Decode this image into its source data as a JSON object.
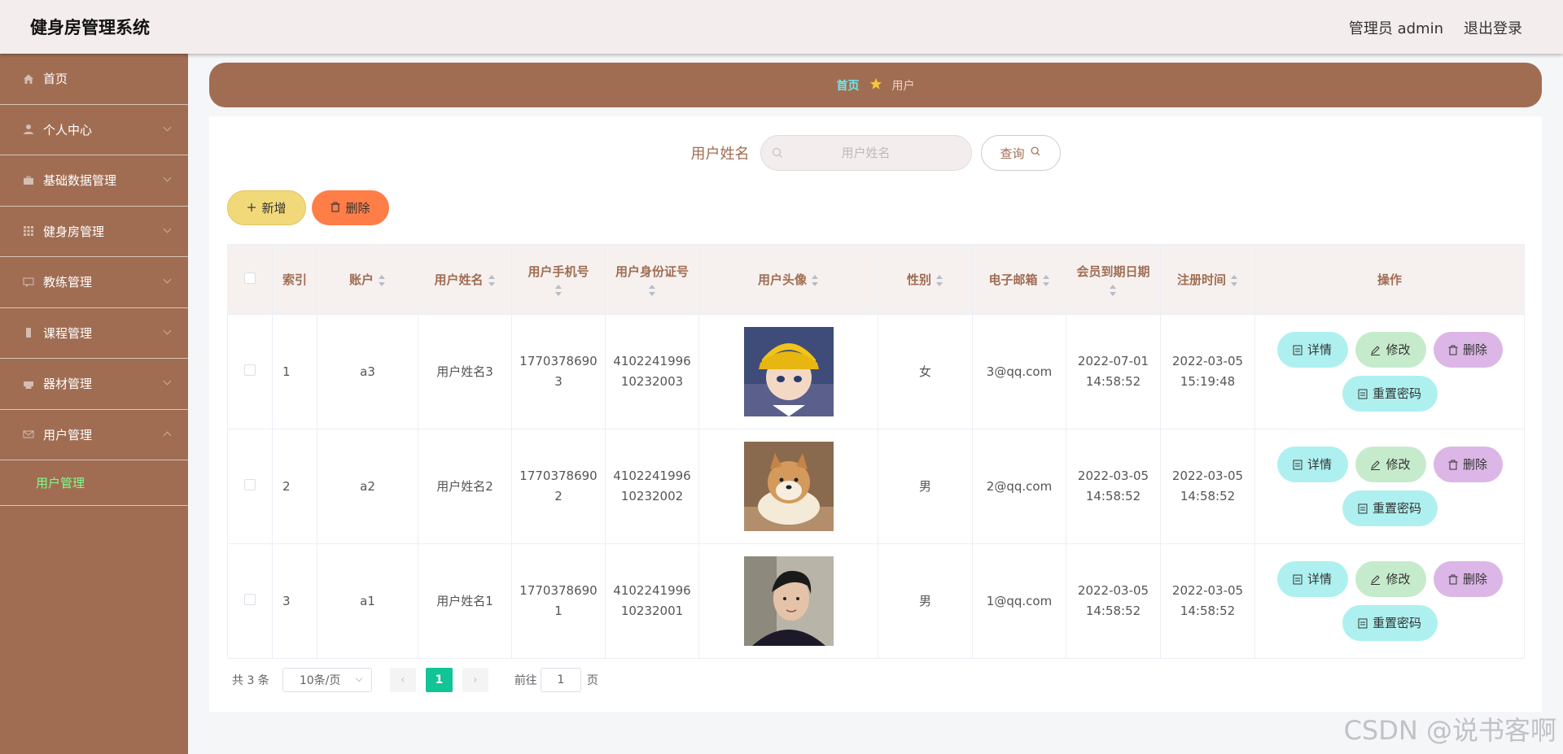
{
  "header": {
    "title": "健身房管理系统",
    "user": "管理员 admin",
    "logout": "退出登录"
  },
  "sidebar": {
    "items": [
      {
        "label": "首页",
        "icon": "home-icon"
      },
      {
        "label": "个人中心",
        "icon": "user-icon"
      },
      {
        "label": "基础数据管理",
        "icon": "briefcase-icon"
      },
      {
        "label": "健身房管理",
        "icon": "grid-icon"
      },
      {
        "label": "教练管理",
        "icon": "chat-icon"
      },
      {
        "label": "课程管理",
        "icon": "phone-icon"
      },
      {
        "label": "器材管理",
        "icon": "printer-icon"
      },
      {
        "label": "用户管理",
        "icon": "mail-icon"
      }
    ],
    "subitem": "用户管理"
  },
  "breadcrumb": {
    "home": "首页",
    "current": "用户"
  },
  "search": {
    "label": "用户姓名",
    "placeholder": "用户姓名",
    "button": "查询"
  },
  "actions": {
    "add": "新增",
    "delete": "删除"
  },
  "table": {
    "headers": [
      "索引",
      "账户",
      "用户姓名",
      "用户手机号",
      "用户身份证号",
      "用户头像",
      "性别",
      "电子邮箱",
      "会员到期日期",
      "注册时间",
      "操作"
    ],
    "rows": [
      {
        "index": "1",
        "account": "a3",
        "name": "用户姓名3",
        "phone_a": "1770378690",
        "phone_b": "3",
        "id_a": "4102241996",
        "id_b": "10232003",
        "gender": "女",
        "email": "3@qq.com",
        "expire_a": "2022-07-01",
        "expire_b": "14:58:52",
        "reg_a": "2022-03-05",
        "reg_b": "15:19:48"
      },
      {
        "index": "2",
        "account": "a2",
        "name": "用户姓名2",
        "phone_a": "1770378690",
        "phone_b": "2",
        "id_a": "4102241996",
        "id_b": "10232002",
        "gender": "男",
        "email": "2@qq.com",
        "expire_a": "2022-03-05",
        "expire_b": "14:58:52",
        "reg_a": "2022-03-05",
        "reg_b": "14:58:52"
      },
      {
        "index": "3",
        "account": "a1",
        "name": "用户姓名1",
        "phone_a": "1770378690",
        "phone_b": "1",
        "id_a": "4102241996",
        "id_b": "10232001",
        "gender": "男",
        "email": "1@qq.com",
        "expire_a": "2022-03-05",
        "expire_b": "14:58:52",
        "reg_a": "2022-03-05",
        "reg_b": "14:58:52"
      }
    ],
    "ops": {
      "detail": "详情",
      "edit": "修改",
      "delete": "删除",
      "reset": "重置密码"
    }
  },
  "pagination": {
    "total": "共 3 条",
    "page_size": "10条/页",
    "current": "1",
    "goto_label": "前往",
    "goto_value": "1",
    "goto_suffix": "页"
  },
  "watermark": "CSDN @说书客啊",
  "colors": {
    "brand": "#a06d53",
    "header_bg": "#f4eded",
    "active_page": "#13c497",
    "add_button": "#f1d97a",
    "delete_button": "#ff7d47"
  }
}
